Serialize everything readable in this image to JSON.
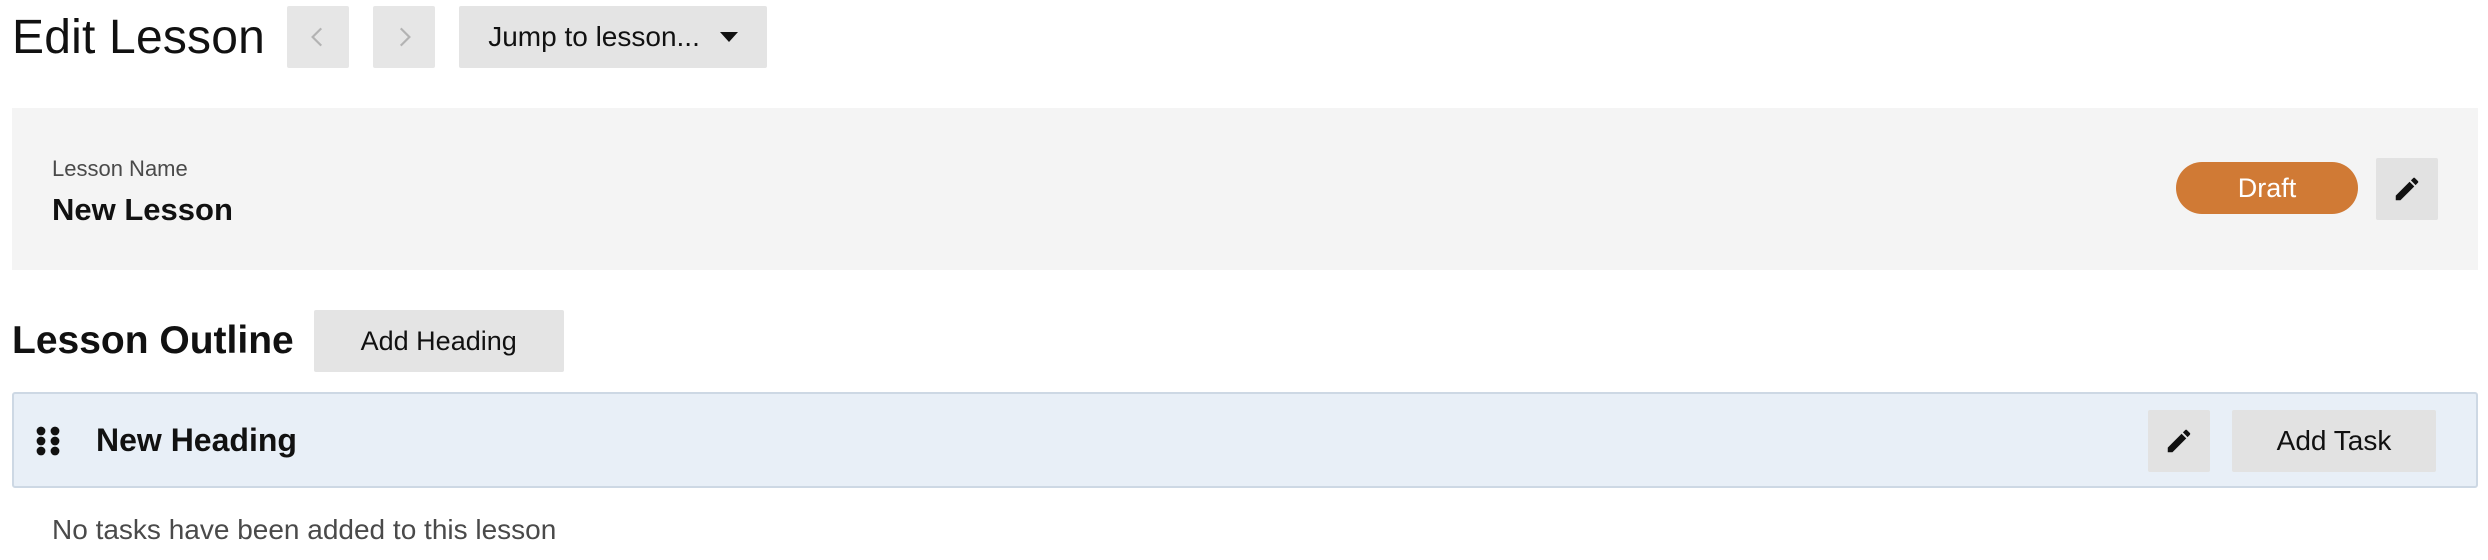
{
  "header": {
    "title": "Edit Lesson",
    "prev_icon": "chevron-left-icon",
    "next_icon": "chevron-right-icon",
    "jump_label": "Jump to lesson...",
    "jump_icon": "caret-down-icon"
  },
  "lesson": {
    "name_label": "Lesson Name",
    "name_value": "New Lesson",
    "status": "Draft",
    "status_color": "#d07a35",
    "edit_icon": "pencil-icon"
  },
  "outline": {
    "title": "Lesson Outline",
    "add_heading_label": "Add Heading",
    "headings": [
      {
        "title": "New Heading",
        "drag_icon": "drag-handle-icon",
        "edit_icon": "pencil-icon",
        "add_task_label": "Add Task",
        "highlight_color": "#e8eff7"
      }
    ],
    "empty_message": "No tasks have been added to this lesson"
  }
}
